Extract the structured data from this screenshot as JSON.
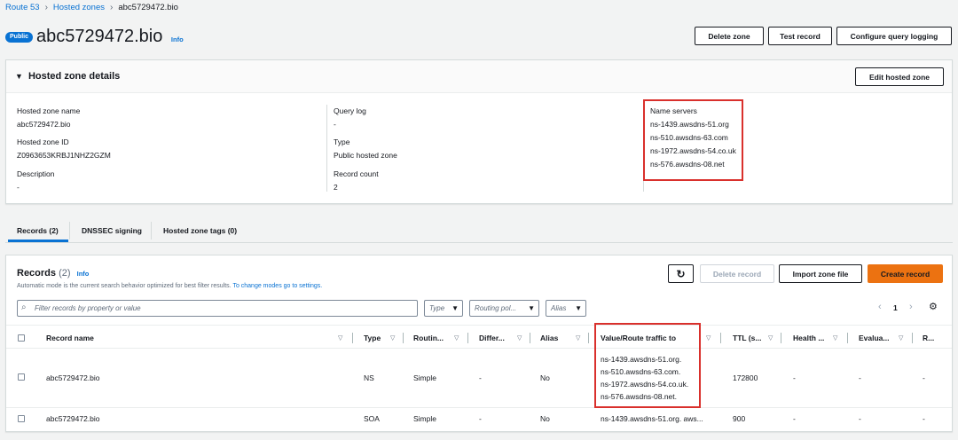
{
  "breadcrumb": {
    "root": "Route 53",
    "parent": "Hosted zones",
    "current": "abc5729472.bio"
  },
  "header": {
    "badge": "Public",
    "title": "abc5729472.bio",
    "info": "Info",
    "buttons": {
      "delete": "Delete zone",
      "test": "Test record",
      "query_logging": "Configure query logging"
    }
  },
  "details": {
    "title": "Hosted zone details",
    "edit_button": "Edit hosted zone",
    "zone_name_label": "Hosted zone name",
    "zone_name": "abc5729472.bio",
    "zone_id_label": "Hosted zone ID",
    "zone_id": "Z0963653KRBJ1NHZ2GZM",
    "description_label": "Description",
    "description": "-",
    "query_log_label": "Query log",
    "query_log": "-",
    "type_label": "Type",
    "type": "Public hosted zone",
    "record_count_label": "Record count",
    "record_count": "2",
    "name_servers_label": "Name servers",
    "name_servers": [
      "ns-1439.awsdns-51.org",
      "ns-510.awsdns-63.com",
      "ns-1972.awsdns-54.co.uk",
      "ns-576.awsdns-08.net"
    ]
  },
  "tabs": [
    "Records (2)",
    "DNSSEC signing",
    "Hosted zone tags (0)"
  ],
  "records": {
    "title": "Records",
    "count": "(2)",
    "info": "Info",
    "desc_text": "Automatic mode is the current search behavior optimized for best filter results.",
    "desc_link": "To change modes go to settings.",
    "buttons": {
      "refresh": "↻",
      "delete": "Delete record",
      "import": "Import zone file",
      "create": "Create record"
    },
    "filter_placeholder": "Filter records by property or value",
    "selects": [
      "Type",
      "Routing pol...",
      "Alias"
    ],
    "page": "1",
    "columns": [
      "Record name",
      "Type",
      "Routin...",
      "Differ...",
      "Alias",
      "Value/Route traffic to",
      "TTL (s...",
      "Health ...",
      "Evalua...",
      "R..."
    ],
    "rows": [
      {
        "name": "abc5729472.bio",
        "type": "NS",
        "routing": "Simple",
        "differ": "-",
        "alias": "No",
        "values": [
          "ns-1439.awsdns-51.org.",
          "ns-510.awsdns-63.com.",
          "ns-1972.awsdns-54.co.uk.",
          "ns-576.awsdns-08.net."
        ],
        "ttl": "172800",
        "health": "-",
        "eval": "-",
        "r": "-"
      },
      {
        "name": "abc5729472.bio",
        "type": "SOA",
        "routing": "Simple",
        "differ": "-",
        "alias": "No",
        "values": [
          "ns-1439.awsdns-51.org. aws..."
        ],
        "ttl": "900",
        "health": "-",
        "eval": "-",
        "r": "-"
      }
    ]
  },
  "colors": {
    "link": "#0972d3",
    "primary": "#ec7211",
    "highlight": "#d9302c"
  }
}
